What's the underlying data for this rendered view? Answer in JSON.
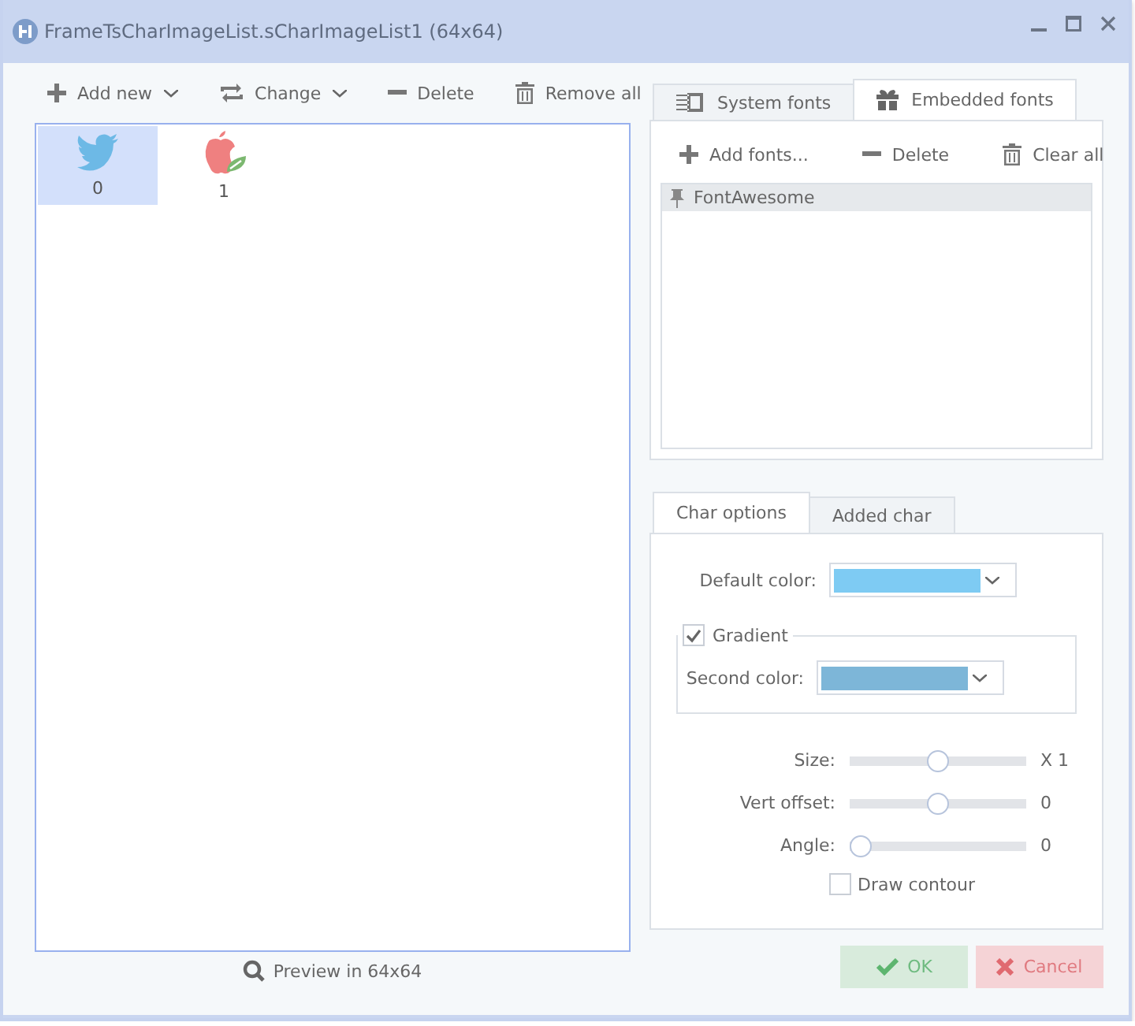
{
  "window": {
    "title": "FrameTsCharImageList.sCharImageList1 (64x64)"
  },
  "toolbar": [
    {
      "label": "Add new",
      "kind": "add",
      "menu": true
    },
    {
      "label": "Change",
      "kind": "change",
      "menu": true
    },
    {
      "label": "Delete",
      "kind": "delete",
      "menu": false
    },
    {
      "label": "Remove all",
      "kind": "clear",
      "menu": false
    }
  ],
  "images": [
    {
      "index": "0",
      "kind": "bird",
      "selected": true
    },
    {
      "index": "1",
      "kind": "apple",
      "selected": false
    }
  ],
  "preview": {
    "label": "Preview in 64x64"
  },
  "font_tabs": [
    {
      "label": "System fonts",
      "kind": "system",
      "selected": false
    },
    {
      "label": "Embedded fonts",
      "kind": "gift",
      "selected": true
    }
  ],
  "font_toolbar": [
    {
      "label": "Add fonts...",
      "kind": "add"
    },
    {
      "label": "Delete",
      "kind": "delete"
    },
    {
      "label": "Clear all",
      "kind": "clear"
    }
  ],
  "fonts": [
    {
      "name": "FontAwesome",
      "selected": true
    }
  ],
  "char_tabs": [
    {
      "label": "Char options",
      "selected": true
    },
    {
      "label": "Added char",
      "selected": false
    }
  ],
  "default_color": {
    "label": "Default color:",
    "color": "#7ecbf3"
  },
  "gradient": {
    "label": "Gradient",
    "checked": true,
    "second_color": {
      "label": "Second color:",
      "color": "#7db6d8"
    }
  },
  "sliders": [
    {
      "label": "Size:",
      "level": 0.5,
      "reading": "X 1"
    },
    {
      "label": "Vert offset:",
      "level": 0.5,
      "reading": "0"
    },
    {
      "label": "Angle:",
      "level": 0,
      "reading": "0"
    }
  ],
  "draw_contour": {
    "label": "Draw contour",
    "checked": false
  },
  "buttons": [
    {
      "label": "OK",
      "kind": "ok"
    },
    {
      "label": "Cancel",
      "kind": "cancel"
    }
  ]
}
